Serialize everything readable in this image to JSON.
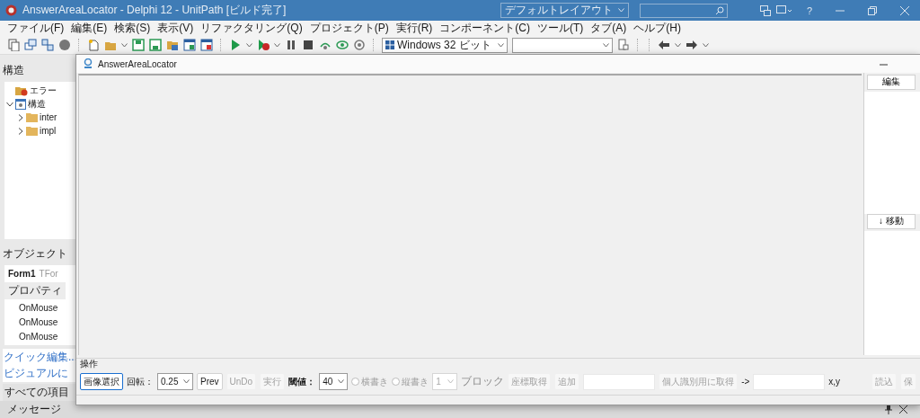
{
  "ide": {
    "title": "AnswerAreaLocator - Delphi 12 - UnitPath [ビルド完了]",
    "layout_dropdown": "デフォルトレイアウト",
    "help": "?"
  },
  "menu": [
    {
      "label": "ファイル(F)"
    },
    {
      "label": "編集(E)"
    },
    {
      "label": "検索(S)"
    },
    {
      "label": "表示(V)"
    },
    {
      "label": "リファクタリング(Q)"
    },
    {
      "label": "プロジェクト(P)"
    },
    {
      "label": "実行(R)"
    },
    {
      "label": "コンポーネント(C)"
    },
    {
      "label": "ツール(T)"
    },
    {
      "label": "タブ(A)"
    },
    {
      "label": "ヘルプ(H)"
    }
  ],
  "toolbar": {
    "platform": "Windows 32 ビット"
  },
  "structure": {
    "title": "構造",
    "tree": [
      {
        "label": "エラー",
        "kind": "error"
      },
      {
        "label": "構造",
        "kind": "structure",
        "expanded": true,
        "children": [
          {
            "label": "inter",
            "kind": "folder",
            "expanded": false
          },
          {
            "label": "impl",
            "kind": "folder",
            "expanded": false
          }
        ]
      }
    ]
  },
  "object_inspector": {
    "title": "オブジェクト",
    "form_name": "Form1",
    "form_type": "TFor",
    "tab": "プロパティ",
    "properties": [
      "OnMouse",
      "OnMouse",
      "OnMouse"
    ],
    "links": [
      "クイック編集...",
      "ビジュアルに"
    ],
    "filter": "すべての項目"
  },
  "messages": {
    "title": "メッセージ"
  },
  "app_window": {
    "title": "AnswerAreaLocator",
    "side_buttons": [
      {
        "label": "編集"
      },
      {
        "label": "↓ 移動"
      }
    ],
    "group": {
      "title": "操作",
      "controls": [
        {
          "kind": "button",
          "label": "画像選択",
          "disabled": false,
          "focused": true
        },
        {
          "kind": "label",
          "text": "回転：",
          "bold": false
        },
        {
          "kind": "combo",
          "value": "0.25",
          "disabled": false
        },
        {
          "kind": "button",
          "label": "Prev",
          "disabled": false,
          "focused": false
        },
        {
          "kind": "button",
          "label": "UnDo",
          "disabled": true,
          "focused": false
        },
        {
          "kind": "button",
          "label": "実行",
          "disabled": true,
          "focused": false
        },
        {
          "kind": "label",
          "text": "閾値：",
          "bold": true
        },
        {
          "kind": "combo",
          "value": "40",
          "disabled": false
        },
        {
          "kind": "radio",
          "label": "横書き",
          "selected": false,
          "disabled": true
        },
        {
          "kind": "radio",
          "label": "縦書き",
          "selected": false,
          "disabled": true
        },
        {
          "kind": "combo",
          "value": "1",
          "disabled": true
        },
        {
          "kind": "label",
          "text": "ブロック",
          "bold": false,
          "disabled": true
        },
        {
          "kind": "button",
          "label": "座標取得",
          "disabled": true,
          "focused": false
        },
        {
          "kind": "button",
          "label": "追加",
          "disabled": true,
          "focused": false
        },
        {
          "kind": "input"
        },
        {
          "kind": "button",
          "label": "個人識別用に取得",
          "disabled": true,
          "focused": false
        },
        {
          "kind": "label",
          "text": "->",
          "bold": false
        },
        {
          "kind": "input"
        },
        {
          "kind": "label",
          "text": "x,y",
          "bold": false
        },
        {
          "kind": "button",
          "label": "読込",
          "disabled": true,
          "focused": false
        },
        {
          "kind": "button",
          "label": "保",
          "disabled": true,
          "focused": false
        }
      ]
    }
  }
}
